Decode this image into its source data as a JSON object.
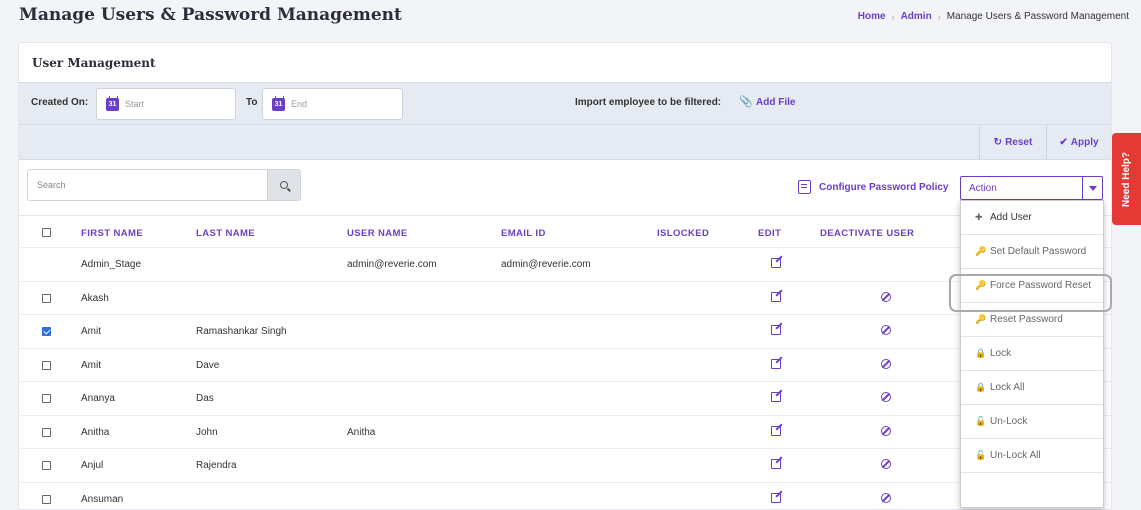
{
  "page": {
    "title": "Manage Users & Password Management"
  },
  "breadcrumb": {
    "home": "Home",
    "admin": "Admin",
    "current": "Manage Users & Password Management"
  },
  "card": {
    "title": "User Management"
  },
  "filters": {
    "created_on_label": "Created On:",
    "start_placeholder": "Start",
    "to_label": "To",
    "end_placeholder": "End",
    "calendar_day": "31",
    "import_label": "Import employee to be filtered:",
    "add_file_label": "Add File",
    "reset_label": "Reset",
    "apply_label": "Apply"
  },
  "toolbar": {
    "search_placeholder": "Search",
    "configure_policy_label": "Configure Password Policy",
    "action_selected": "Action"
  },
  "table": {
    "columns": [
      "FIRST NAME",
      "LAST NAME",
      "USER NAME",
      "EMAIL ID",
      "ISLOCKED",
      "EDIT",
      "DEACTIVATE USER"
    ],
    "rows": [
      {
        "first": "Admin_Stage",
        "last": "",
        "user": "admin@reverie.com",
        "email": "admin@reverie.com",
        "checkbox": false,
        "checked": false,
        "deactivate": false
      },
      {
        "first": "Akash",
        "last": "",
        "user": "",
        "email": "",
        "checkbox": true,
        "checked": false,
        "deactivate": true
      },
      {
        "first": "Amit",
        "last": "Ramashankar Singh",
        "user": "",
        "email": "",
        "checkbox": true,
        "checked": true,
        "deactivate": true
      },
      {
        "first": "Amit",
        "last": "Dave",
        "user": "",
        "email": "",
        "checkbox": true,
        "checked": false,
        "deactivate": true
      },
      {
        "first": "Ananya",
        "last": "Das",
        "user": "",
        "email": "",
        "checkbox": true,
        "checked": false,
        "deactivate": true
      },
      {
        "first": "Anitha",
        "last": "John",
        "user": "Anitha",
        "email": "",
        "checkbox": true,
        "checked": false,
        "deactivate": true
      },
      {
        "first": "Anjul",
        "last": "Rajendra",
        "user": "",
        "email": "",
        "checkbox": true,
        "checked": false,
        "deactivate": true
      },
      {
        "first": "Ansuman",
        "last": "",
        "user": "",
        "email": "",
        "checkbox": true,
        "checked": false,
        "deactivate": true
      }
    ]
  },
  "action_menu": {
    "items": [
      {
        "label": "Add User",
        "icon": "plus-icon"
      },
      {
        "label": "Set Default Password",
        "icon": "key-icon"
      },
      {
        "label": "Force Password Reset",
        "icon": "key-icon"
      },
      {
        "label": "Reset Password",
        "icon": "key-icon"
      },
      {
        "label": "Lock",
        "icon": "lock-icon"
      },
      {
        "label": "Lock All",
        "icon": "lock-icon"
      },
      {
        "label": "Un-Lock",
        "icon": "unlock-icon"
      },
      {
        "label": "Un-Lock All",
        "icon": "unlock-icon"
      }
    ]
  },
  "help": {
    "label": "Need Help?"
  },
  "colors": {
    "accent": "#6a3fc7",
    "help_tab": "#e53935",
    "filter_bg": "#e6ebf3"
  }
}
